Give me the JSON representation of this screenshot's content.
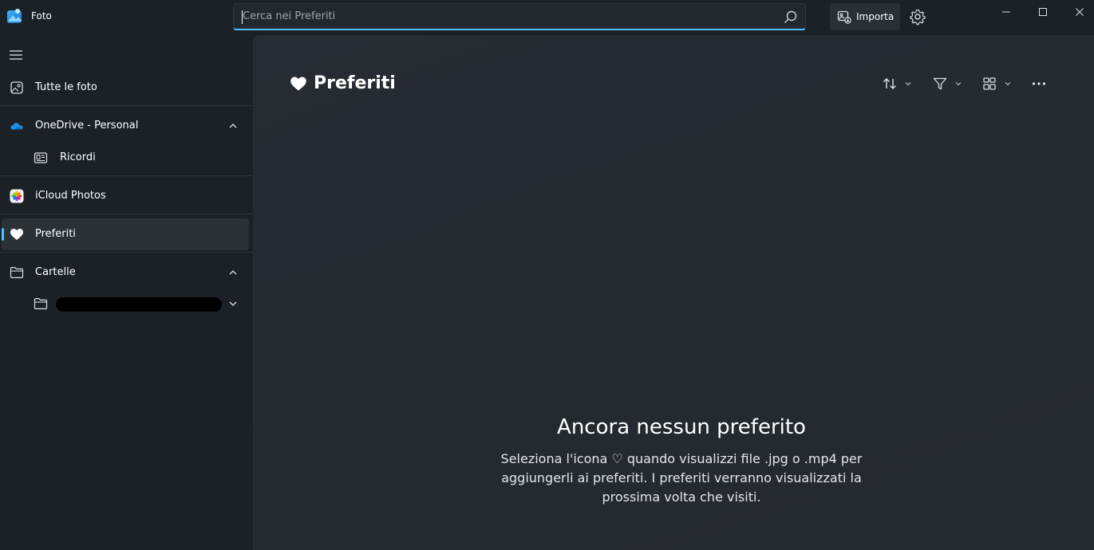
{
  "app": {
    "title": "Foto"
  },
  "search": {
    "placeholder": "Cerca nei Preferiti",
    "value": ""
  },
  "toolbar": {
    "import_label": "Importa"
  },
  "sidebar": {
    "items": [
      {
        "label": "Tutte le foto"
      },
      {
        "label": "OneDrive - Personal"
      },
      {
        "label": "Ricordi"
      },
      {
        "label": "iCloud Photos"
      },
      {
        "label": "Preferiti"
      },
      {
        "label": "Cartelle"
      }
    ]
  },
  "main": {
    "title": "Preferiti",
    "empty_title": "Ancora nessun preferito",
    "empty_desc": "Seleziona l'icona ♡ quando visualizzi file .jpg o .mp4 per aggiungerli ai preferiti. I preferiti verranno visualizzati la prossima volta che visiti."
  },
  "colors": {
    "accent": "#4cc2ff",
    "background": "#1c2128",
    "content": "#262a31"
  }
}
